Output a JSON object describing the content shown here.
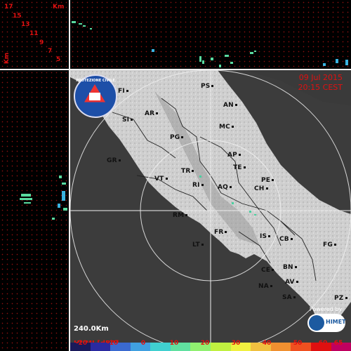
{
  "corner": {
    "km_label": "Km",
    "km_vertical": "Km",
    "levels": [
      "17",
      "15",
      "13",
      "11",
      "9",
      "7",
      "5"
    ]
  },
  "map": {
    "date": "09 Jul 2015",
    "time": "20:15 CEST",
    "scale": "240.0Km",
    "units": "HVMI [dBZ]",
    "logo_text": "PROTEZIONE CIVILE",
    "powered_by": "Powered by",
    "brand": "HIMET",
    "cities": [
      "FI",
      "PS",
      "AN",
      "SI",
      "AR",
      "MC",
      "PG",
      "GR",
      "AP",
      "TE",
      "TR",
      "RI",
      "PE",
      "VT",
      "AQ",
      "CH",
      "RM",
      "FR",
      "IS",
      "CB",
      "FG",
      "LT",
      "CE",
      "BN",
      "NA",
      "AV",
      "SA",
      "PZ"
    ],
    "legend_ticks": [
      "-20",
      "-10",
      "0",
      "10",
      "20",
      "30",
      "40",
      "50",
      "60",
      "65"
    ],
    "legend_colors": [
      "#1a1a5a",
      "#2a2aa0",
      "#3a6ad0",
      "#40a0e0",
      "#40d0d0",
      "#60e0a0",
      "#90f070",
      "#c0f040",
      "#f0f040",
      "#f0c040",
      "#f09030",
      "#f05020",
      "#e01010",
      "#c00060"
    ]
  }
}
